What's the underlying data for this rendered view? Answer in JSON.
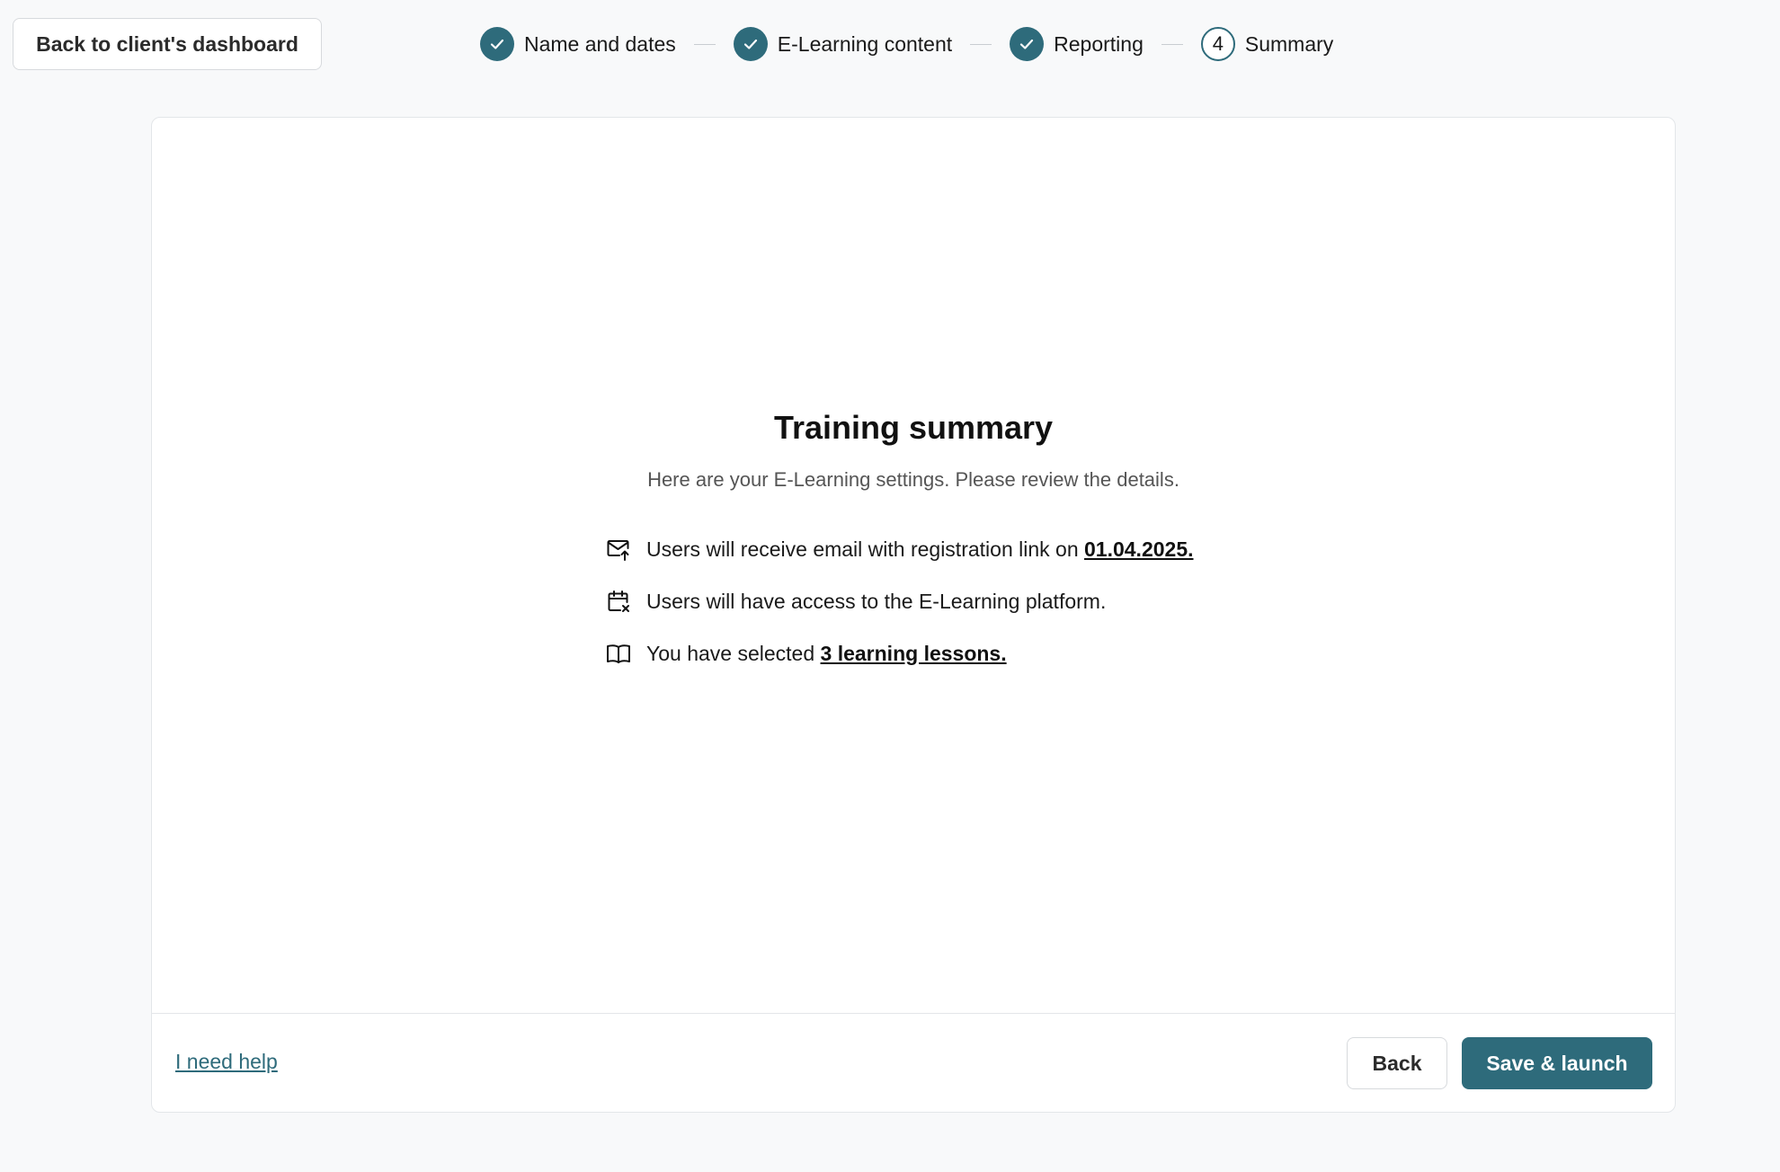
{
  "header": {
    "back_label": "Back to client's dashboard"
  },
  "stepper": {
    "steps": [
      {
        "label": "Name and dates",
        "status": "completed",
        "icon": "check-icon"
      },
      {
        "label": "E-Learning content",
        "status": "completed",
        "icon": "check-icon"
      },
      {
        "label": "Reporting",
        "status": "completed",
        "icon": "check-icon"
      },
      {
        "label": "Summary",
        "status": "current",
        "number": "4"
      }
    ]
  },
  "summary": {
    "title": "Training summary",
    "subtitle": "Here are your E-Learning settings. Please review the details.",
    "items": [
      {
        "icon": "mail-upload-icon",
        "text": "Users will receive email with registration link on ",
        "link": "01.04.2025."
      },
      {
        "icon": "calendar-x-icon",
        "text": "Users will have access to the E-Learning platform."
      },
      {
        "icon": "open-book-icon",
        "text": "You have selected ",
        "link": "3 learning lessons."
      }
    ]
  },
  "footer": {
    "help_label": "I need help",
    "back_label": "Back",
    "launch_label": "Save & launch"
  },
  "colors": {
    "accent": "#2e6b7b",
    "background": "#f8f9fa",
    "card": "#ffffff",
    "border": "#e3e6e9"
  }
}
